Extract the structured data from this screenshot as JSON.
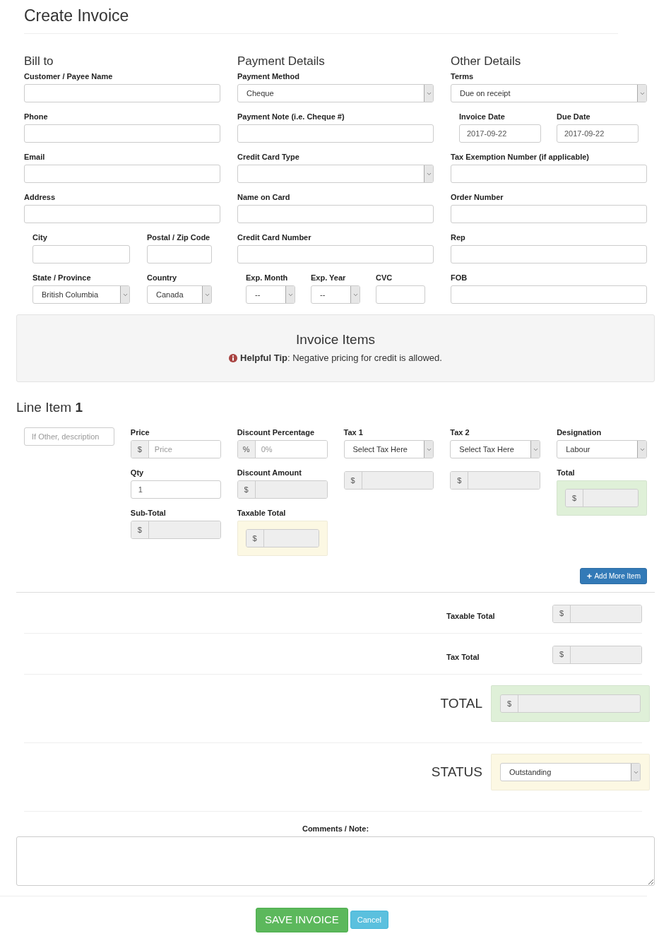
{
  "title": "Create Invoice",
  "bill_to": {
    "heading": "Bill to",
    "fields": [
      {
        "label": "Customer / Payee Name",
        "kind": "text"
      },
      {
        "label": "Phone",
        "kind": "text"
      },
      {
        "label": "Email",
        "kind": "text"
      },
      {
        "label": "Address",
        "kind": "text"
      }
    ],
    "pairs": [
      [
        {
          "label": "City",
          "kind": "text"
        },
        {
          "label": "Postal / Zip Code",
          "kind": "text"
        }
      ],
      [
        {
          "label": "State / Province",
          "kind": "select",
          "value": "British Columbia"
        },
        {
          "label": "Country",
          "kind": "select",
          "value": "Canada"
        }
      ]
    ]
  },
  "payment": {
    "heading": "Payment Details",
    "fields": [
      {
        "label": "Payment Method",
        "kind": "select",
        "value": "Cheque"
      },
      {
        "label": "Payment Note (i.e. Cheque #)",
        "kind": "text"
      },
      {
        "label": "Credit Card Type",
        "kind": "select"
      },
      {
        "label": "Name on Card",
        "kind": "text"
      },
      {
        "label": "Credit Card Number",
        "kind": "text"
      }
    ],
    "expiry": [
      {
        "label": "Exp. Month",
        "kind": "select",
        "value": "--"
      },
      {
        "label": "Exp. Year",
        "kind": "select",
        "value": "--"
      },
      {
        "label": "CVC",
        "kind": "text"
      }
    ]
  },
  "other": {
    "heading": "Other Details",
    "terms": {
      "label": "Terms",
      "kind": "select",
      "value": "Due on receipt"
    },
    "dates": [
      {
        "label": "Invoice Date",
        "kind": "text",
        "value": "2017-09-22"
      },
      {
        "label": "Due Date",
        "kind": "text",
        "value": "2017-09-22"
      }
    ],
    "fields": [
      {
        "label": "Tax Exemption Number (if applicable)",
        "kind": "text"
      },
      {
        "label": "Order Number",
        "kind": "text"
      },
      {
        "label": "Rep",
        "kind": "text"
      },
      {
        "label": "FOB",
        "kind": "text"
      }
    ]
  },
  "items_panel": {
    "heading": "Invoice Items",
    "tip": "**Helpful Tip**: Negative pricing for credit is allowed."
  },
  "line_item": {
    "heading": "Line Item **1**",
    "description": {
      "kind": "text",
      "placeholder": "If Other, description"
    },
    "columns": [
      [
        {
          "label": "Price",
          "kind": "addon",
          "addon": "$",
          "placeholder": "Price",
          "readonly": false
        },
        {
          "label": "Qty",
          "kind": "text",
          "value": "1"
        },
        {
          "label": "Sub-Total",
          "kind": "addon",
          "addon": "$",
          "readonly": true
        }
      ],
      [
        {
          "label": "Discount Percentage",
          "kind": "addon",
          "addon": "%",
          "placeholder": "0%",
          "readonly": false
        },
        {
          "label": "Discount Amount",
          "kind": "addon",
          "addon": "$",
          "readonly": true
        },
        {
          "label": "Taxable Total",
          "kind": "addon",
          "addon": "$",
          "readonly": true,
          "color": "#fcf8e3"
        }
      ],
      [
        {
          "label": "Tax 1",
          "kind": "select",
          "value": "Select Tax Here"
        },
        {
          "kind": "addon",
          "addon": "$",
          "readonly": true
        }
      ],
      [
        {
          "label": "Tax 2",
          "kind": "select",
          "value": "Select Tax Here"
        },
        {
          "kind": "addon",
          "addon": "$",
          "readonly": true
        }
      ],
      [
        {
          "label": "Designation",
          "kind": "select",
          "value": "Labour"
        },
        {
          "label": "Total",
          "kind": "addon",
          "addon": "$",
          "readonly": true,
          "color": "#dff0d8"
        }
      ]
    ]
  },
  "add_button": "Add More Item",
  "summary": [
    {
      "label": "Taxable Total",
      "kind": "small",
      "field": {
        "kind": "addon",
        "addon": "$",
        "readonly": true
      }
    },
    {
      "label": "Tax Total",
      "kind": "small",
      "field": {
        "kind": "addon",
        "addon": "$",
        "readonly": true
      }
    },
    {
      "label": "TOTAL",
      "kind": "large",
      "color": "#dff0d8",
      "field": {
        "kind": "addon",
        "addon": "$",
        "readonly": true
      }
    },
    {
      "label": "STATUS",
      "kind": "large",
      "color": "#fcf8e3",
      "field": {
        "kind": "select",
        "value": "Outstanding"
      }
    }
  ],
  "comments": {
    "label": "Comments / Note:"
  },
  "buttons": [
    {
      "label": "SAVE INVOICE",
      "kind": "primary"
    },
    {
      "label": "Cancel",
      "kind": "secondary"
    }
  ]
}
